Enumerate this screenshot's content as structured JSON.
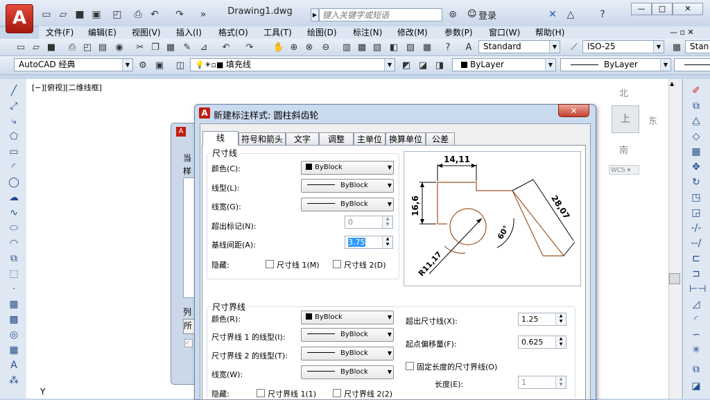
{
  "app": {
    "logo": "A",
    "doc_title": "Drawing1.dwg",
    "search_placeholder": "键入关键字或短语",
    "login": "登录",
    "win_controls": [
      "—",
      "□",
      "✕"
    ]
  },
  "menubar": [
    "文件(F)",
    "编辑(E)",
    "视图(V)",
    "插入(I)",
    "格式(O)",
    "工具(T)",
    "绘图(D)",
    "标注(N)",
    "修改(M)",
    "参数(P)",
    "窗口(W)",
    "帮助(H)"
  ],
  "toolbar": {
    "text_style": "Standard",
    "dim_style": "ISO-25",
    "table_style": "Stan",
    "workspace": "AutoCAD 经典",
    "layer": "填充线",
    "color": "ByLayer",
    "linetype": "ByLayer"
  },
  "canvas": {
    "view_label": "[−][俯视][二维线框]",
    "compass": {
      "n": "北",
      "s": "南",
      "e": "东",
      "top": "上",
      "wcs": "WCS"
    },
    "ucs_y": "Y"
  },
  "back_dialog": {
    "frag1": "当",
    "frag2": "样",
    "frag3": "列",
    "frag4": "所"
  },
  "dialog": {
    "title": "新建标注样式: 圆柱斜齿轮",
    "tabs": [
      "线",
      "符号和箭头",
      "文字",
      "调整",
      "主单位",
      "换算单位",
      "公差"
    ],
    "dimline": {
      "group": "尺寸线",
      "color_label": "颜色(C):",
      "color_value": "ByBlock",
      "linetype_label": "线型(L):",
      "linetype_value": "ByBlock",
      "lineweight_label": "线宽(G):",
      "lineweight_value": "ByBlock",
      "extend_label": "超出标记(N):",
      "extend_value": "0",
      "baseline_label": "基线间距(A):",
      "baseline_value": "3.75",
      "suppress_label": "隐藏:",
      "suppress1": "尺寸线 1(M)",
      "suppress2": "尺寸线 2(D)"
    },
    "extline": {
      "group": "尺寸界线",
      "color_label": "颜色(R):",
      "color_value": "ByBlock",
      "lt1_label": "尺寸界线 1 的线型(I):",
      "lt1_value": "ByBlock",
      "lt2_label": "尺寸界线 2 的线型(T):",
      "lt2_value": "ByBlock",
      "lw_label": "线宽(W):",
      "lw_value": "ByBlock",
      "suppress_label": "隐藏:",
      "suppress1": "尺寸界线 1(1)",
      "suppress2": "尺寸界线 2(2)",
      "beyond_label": "超出尺寸线(X):",
      "beyond_value": "1.25",
      "offset_label": "起点偏移量(F):",
      "offset_value": "0.625",
      "fixed_label": "固定长度的尺寸界线(O)",
      "length_label": "长度(E):",
      "length_value": "1"
    },
    "preview": {
      "dim_top": "14,11",
      "dim_left": "16,6",
      "dim_right": "28,07",
      "dim_angle": "60°",
      "dim_radius": "R11,17"
    }
  }
}
